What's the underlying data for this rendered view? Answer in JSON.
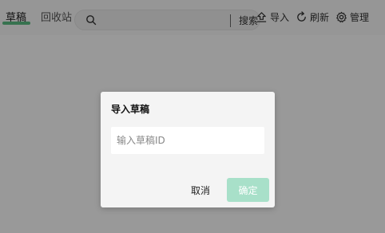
{
  "tabs": {
    "active": "草稿",
    "recycle": "回收站"
  },
  "search": {
    "placeholder": "",
    "button": "搜索"
  },
  "toolbar": {
    "import": "导入",
    "refresh": "刷新",
    "manage": "管理"
  },
  "colors": {
    "accent": "#5cbf84",
    "confirm_disabled": "#a8e0c9",
    "overlay": "rgba(0,0,0,0.40)"
  },
  "dialog": {
    "title": "导入草稿",
    "input_placeholder": "输入草稿ID",
    "cancel": "取消",
    "confirm": "确定"
  }
}
